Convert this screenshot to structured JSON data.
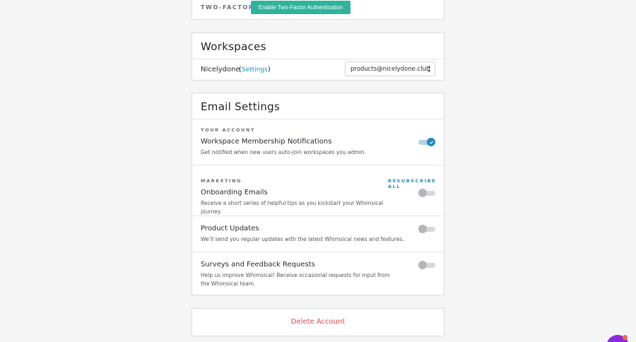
{
  "two_factor": {
    "label": "TWO-FACTOR",
    "button": "Enable Two-Factor Authentication",
    "button_color": "#2fb39d"
  },
  "workspaces": {
    "title": "Workspaces",
    "name": "Nicelydone",
    "settings_link": "Settings",
    "email_select": "products@nicelydone.club"
  },
  "email_settings": {
    "title": "Email Settings",
    "your_account": {
      "label": "YOUR ACCOUNT",
      "items": [
        {
          "title": "Workspace Membership Notifications",
          "desc": "Get notified when new users auto-join workspaces you admin.",
          "enabled": true
        }
      ]
    },
    "marketing": {
      "label": "MARKETING",
      "resubscribe": "RESUBSCRIBE ALL",
      "items": [
        {
          "title": "Onboarding Emails",
          "desc": "Receive a short series of helpful tips as you kickstart your Whimsical journey.",
          "enabled": false
        },
        {
          "title": "Product Updates",
          "desc": "We’ll send you regular updates with the latest Whimsical news and features.",
          "enabled": false
        },
        {
          "title": "Surveys and Feedback Requests",
          "desc": "Help us improve Whimsical! Receive occasional requests for input from the Whimsical team.",
          "enabled": false
        }
      ]
    }
  },
  "delete_account": {
    "label": "Delete Account",
    "color": "#e0474f"
  },
  "accent_color": "#1e8bc3"
}
